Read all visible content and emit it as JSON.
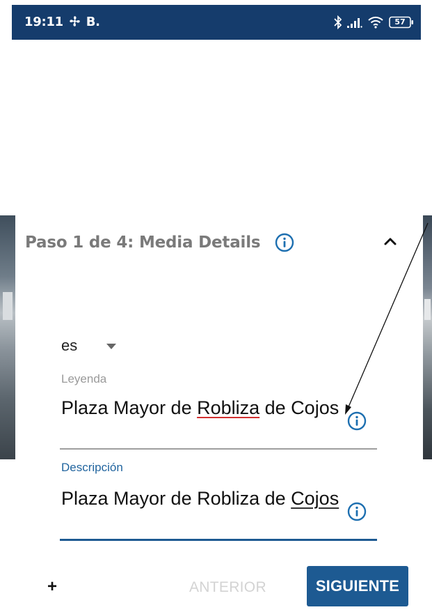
{
  "status_bar": {
    "time": "19:11",
    "carrier": "B.",
    "battery": "57",
    "icons": [
      "fan-icon",
      "bluetooth-icon",
      "signal-icon",
      "wifi-icon",
      "battery-icon"
    ],
    "background_color": "#153c6c"
  },
  "sheet": {
    "step_title": "Paso 1 de 4: Media Details",
    "icons": [
      "info-icon",
      "chevron-up-icon"
    ]
  },
  "form": {
    "language": {
      "selected": "es"
    },
    "caption": {
      "label": "Leyenda",
      "value_part1": "Plaza Mayor de ",
      "value_misspelled": "Robliza",
      "value_part2": " de Cojos"
    },
    "description": {
      "label": "Descripción",
      "value_part1": "Plaza Mayor de Robliza de ",
      "value_underlined": "Cojos"
    }
  },
  "actions": {
    "add_label": "+",
    "previous_label": "ANTERIOR",
    "next_label": "SIGUIENTE"
  },
  "colors": {
    "accent": "#1d5a92",
    "error_underline": "#d32f2f",
    "disabled_text": "#d3d3d3"
  }
}
